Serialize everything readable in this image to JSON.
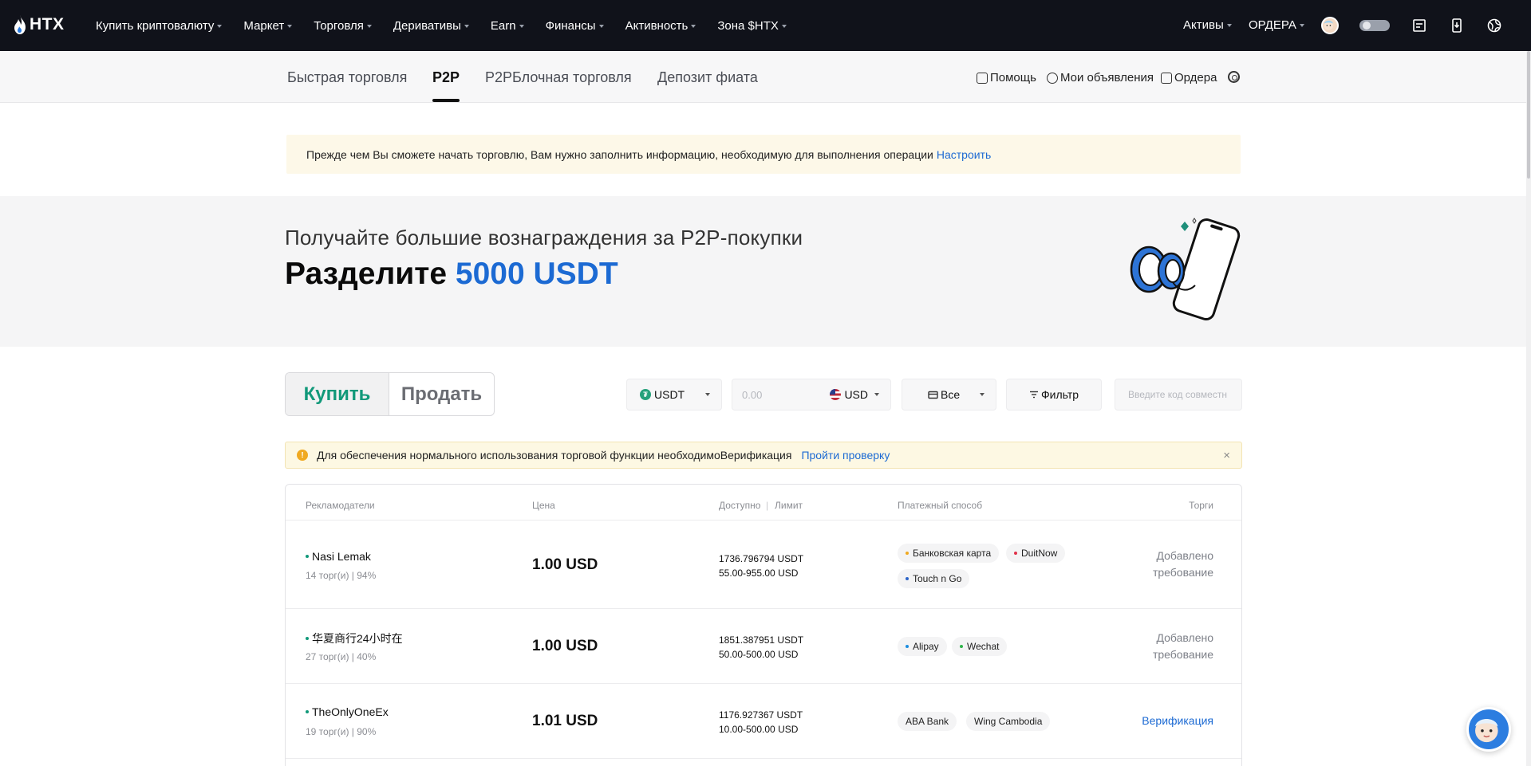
{
  "logo": {
    "text": "HTX"
  },
  "nav": {
    "items": [
      {
        "label": "Купить криптовалюту"
      },
      {
        "label": "Маркет"
      },
      {
        "label": "Торговля"
      },
      {
        "label": "Деривативы"
      },
      {
        "label": "Earn"
      },
      {
        "label": "Финансы"
      },
      {
        "label": "Активность"
      },
      {
        "label": "Зона $HTX"
      }
    ],
    "assets": "Активы",
    "orders": "ОРДЕРА"
  },
  "subnav": {
    "tabs": [
      {
        "label": "Быстрая торговля"
      },
      {
        "label": "P2P"
      },
      {
        "label": "P2PБлочная торговля"
      },
      {
        "label": "Депозит фиата"
      }
    ],
    "active_tab": "P2P",
    "links": {
      "help": "Помощь",
      "my_ads": "Мои объявления",
      "orders": "Ордера"
    }
  },
  "notice": {
    "text": "Прежде чем Вы сможете начать торговлю, Вам нужно заполнить информацию, необходимую для выполнения операции",
    "link": "Настроить"
  },
  "banner": {
    "subtitle": "Получайте большие вознаграждения за P2P-покупки",
    "title_prefix": "Разделите",
    "title_highlight": "5000 USDT"
  },
  "trade": {
    "buy": "Купить",
    "sell": "Продать",
    "coin": "USDT",
    "amount_placeholder": "0.00",
    "currency": "USD",
    "payment": "Все",
    "filter": "Фильтр",
    "code_placeholder": "Введите код совместн"
  },
  "verify": {
    "text": "Для обеспечения нормального использования торговой функции необходимоВерификация",
    "link": "Пройти проверку",
    "close": "×"
  },
  "table": {
    "headers": {
      "advertisers": "Рекламодатели",
      "price": "Цена",
      "available": "Доступно",
      "limit": "Лимит",
      "payment": "Платежный способ",
      "trade": "Торги"
    },
    "rows": [
      {
        "name": "Nasi Lemak",
        "stats": "14 торг(и) | 94%",
        "price": "1.00 USD",
        "available": "1736.796794 USDT",
        "limit": "55.00-955.00 USD",
        "payments": [
          {
            "label": "Банковская карта",
            "color": "#f0a920"
          },
          {
            "label": "DuitNow",
            "color": "#e0314a"
          },
          {
            "label": "Touch n Go",
            "color": "#2c64c8"
          }
        ],
        "action_line1": "Добавлено",
        "action_line2": "требование"
      },
      {
        "name": "华夏商行24小时在",
        "stats": "27 торг(и) | 40%",
        "price": "1.00 USD",
        "available": "1851.387951 USDT",
        "limit": "50.00-500.00 USD",
        "payments": [
          {
            "label": "Alipay",
            "color": "#1c8de0"
          },
          {
            "label": "Wechat",
            "color": "#2fb44a"
          }
        ],
        "action_line1": "Добавлено",
        "action_line2": "требование"
      },
      {
        "name": "TheOnlyOneEx",
        "stats": "19 торг(и) | 90%",
        "price": "1.01 USD",
        "available": "1176.927367 USDT",
        "limit": "10.00-500.00 USD",
        "payments": [
          {
            "label": "ABA Bank",
            "color": ""
          },
          {
            "label": "Wing Cambodia",
            "color": ""
          }
        ],
        "action_line1": "Верификация"
      }
    ]
  },
  "colors": {
    "accent": "#1c6ad3",
    "buy_green": "#11997a",
    "topnav_bg": "#10121a"
  }
}
